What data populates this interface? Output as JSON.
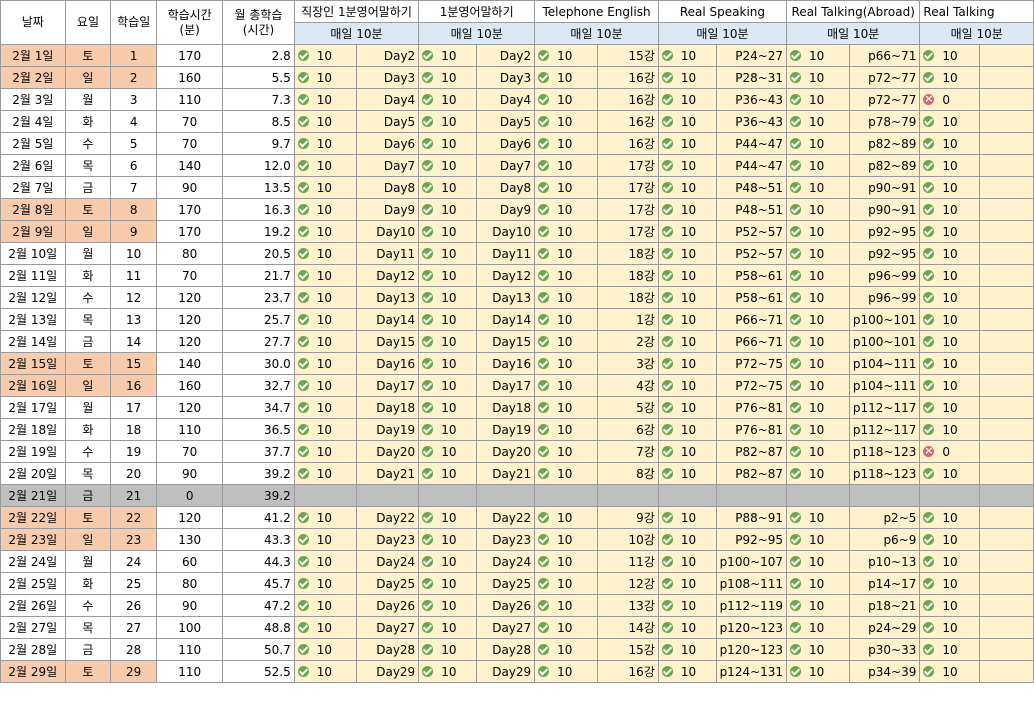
{
  "headers": {
    "date": "날짜",
    "weekday": "요일",
    "study_day": "학습일",
    "study_time": "학습시간\n(분)",
    "monthly_total": "월 총학습\n(시간)"
  },
  "courses": [
    {
      "title": "직장인 1분영어말하기",
      "sub": "매일 10분"
    },
    {
      "title": "1분영어말하기",
      "sub": "매일 10분"
    },
    {
      "title": "Telephone English",
      "sub": "매일 10분"
    },
    {
      "title": "Real Speaking",
      "sub": "매일 10분"
    },
    {
      "title": "Real Talking(Abroad)",
      "sub": "매일 10분"
    },
    {
      "title": "Real Talking",
      "sub": "매일 10분"
    }
  ],
  "status_icons": {
    "done": "check-circle-icon",
    "missed": "cross-circle-icon"
  },
  "colors": {
    "weekend": "#f8cbad",
    "holiday": "#bfbfbf",
    "cell": "#fff2cc",
    "subheader": "#dbe9f5",
    "check": "#6aa84f",
    "cross": "#e06666"
  },
  "rows": [
    {
      "date": "2월 1일",
      "wd": "토",
      "n": "1",
      "min": "170",
      "total": "2.8",
      "weekend": true,
      "off": false,
      "c": [
        [
          "ok",
          "10",
          "Day2"
        ],
        [
          "ok",
          "10",
          "Day2"
        ],
        [
          "ok",
          "10",
          "15강"
        ],
        [
          "ok",
          "10",
          "P24~27"
        ],
        [
          "ok",
          "10",
          "p66~71"
        ],
        [
          "ok",
          "10",
          ""
        ]
      ]
    },
    {
      "date": "2월 2일",
      "wd": "일",
      "n": "2",
      "min": "160",
      "total": "5.5",
      "weekend": true,
      "off": false,
      "c": [
        [
          "ok",
          "10",
          "Day3"
        ],
        [
          "ok",
          "10",
          "Day3"
        ],
        [
          "ok",
          "10",
          "16강"
        ],
        [
          "ok",
          "10",
          "P28~31"
        ],
        [
          "ok",
          "10",
          "p72~77"
        ],
        [
          "ok",
          "10",
          ""
        ]
      ]
    },
    {
      "date": "2월 3일",
      "wd": "월",
      "n": "3",
      "min": "110",
      "total": "7.3",
      "weekend": false,
      "off": false,
      "c": [
        [
          "ok",
          "10",
          "Day4"
        ],
        [
          "ok",
          "10",
          "Day4"
        ],
        [
          "ok",
          "10",
          "16강"
        ],
        [
          "ok",
          "10",
          "P36~43"
        ],
        [
          "ok",
          "10",
          "p72~77"
        ],
        [
          "ng",
          "0",
          ""
        ]
      ]
    },
    {
      "date": "2월 4일",
      "wd": "화",
      "n": "4",
      "min": "70",
      "total": "8.5",
      "weekend": false,
      "off": false,
      "c": [
        [
          "ok",
          "10",
          "Day5"
        ],
        [
          "ok",
          "10",
          "Day5"
        ],
        [
          "ok",
          "10",
          "16강"
        ],
        [
          "ok",
          "10",
          "P36~43"
        ],
        [
          "ok",
          "10",
          "p78~79"
        ],
        [
          "ok",
          "10",
          ""
        ]
      ]
    },
    {
      "date": "2월 5일",
      "wd": "수",
      "n": "5",
      "min": "70",
      "total": "9.7",
      "weekend": false,
      "off": false,
      "c": [
        [
          "ok",
          "10",
          "Day6"
        ],
        [
          "ok",
          "10",
          "Day6"
        ],
        [
          "ok",
          "10",
          "16강"
        ],
        [
          "ok",
          "10",
          "P44~47"
        ],
        [
          "ok",
          "10",
          "p82~89"
        ],
        [
          "ok",
          "10",
          ""
        ]
      ]
    },
    {
      "date": "2월 6일",
      "wd": "목",
      "n": "6",
      "min": "140",
      "total": "12.0",
      "weekend": false,
      "off": false,
      "c": [
        [
          "ok",
          "10",
          "Day7"
        ],
        [
          "ok",
          "10",
          "Day7"
        ],
        [
          "ok",
          "10",
          "17강"
        ],
        [
          "ok",
          "10",
          "P44~47"
        ],
        [
          "ok",
          "10",
          "p82~89"
        ],
        [
          "ok",
          "10",
          ""
        ]
      ]
    },
    {
      "date": "2월 7일",
      "wd": "금",
      "n": "7",
      "min": "90",
      "total": "13.5",
      "weekend": false,
      "off": false,
      "c": [
        [
          "ok",
          "10",
          "Day8"
        ],
        [
          "ok",
          "10",
          "Day8"
        ],
        [
          "ok",
          "10",
          "17강"
        ],
        [
          "ok",
          "10",
          "P48~51"
        ],
        [
          "ok",
          "10",
          "p90~91"
        ],
        [
          "ok",
          "10",
          ""
        ]
      ]
    },
    {
      "date": "2월 8일",
      "wd": "토",
      "n": "8",
      "min": "170",
      "total": "16.3",
      "weekend": true,
      "off": false,
      "c": [
        [
          "ok",
          "10",
          "Day9"
        ],
        [
          "ok",
          "10",
          "Day9"
        ],
        [
          "ok",
          "10",
          "17강"
        ],
        [
          "ok",
          "10",
          "P48~51"
        ],
        [
          "ok",
          "10",
          "p90~91"
        ],
        [
          "ok",
          "10",
          ""
        ]
      ]
    },
    {
      "date": "2월 9일",
      "wd": "일",
      "n": "9",
      "min": "170",
      "total": "19.2",
      "weekend": true,
      "off": false,
      "c": [
        [
          "ok",
          "10",
          "Day10"
        ],
        [
          "ok",
          "10",
          "Day10"
        ],
        [
          "ok",
          "10",
          "17강"
        ],
        [
          "ok",
          "10",
          "P52~57"
        ],
        [
          "ok",
          "10",
          "p92~95"
        ],
        [
          "ok",
          "10",
          ""
        ]
      ]
    },
    {
      "date": "2월 10일",
      "wd": "월",
      "n": "10",
      "min": "80",
      "total": "20.5",
      "weekend": false,
      "off": false,
      "c": [
        [
          "ok",
          "10",
          "Day11"
        ],
        [
          "ok",
          "10",
          "Day11"
        ],
        [
          "ok",
          "10",
          "18강"
        ],
        [
          "ok",
          "10",
          "P52~57"
        ],
        [
          "ok",
          "10",
          "p92~95"
        ],
        [
          "ok",
          "10",
          ""
        ]
      ]
    },
    {
      "date": "2월 11일",
      "wd": "화",
      "n": "11",
      "min": "70",
      "total": "21.7",
      "weekend": false,
      "off": false,
      "c": [
        [
          "ok",
          "10",
          "Day12"
        ],
        [
          "ok",
          "10",
          "Day12"
        ],
        [
          "ok",
          "10",
          "18강"
        ],
        [
          "ok",
          "10",
          "P58~61"
        ],
        [
          "ok",
          "10",
          "p96~99"
        ],
        [
          "ok",
          "10",
          ""
        ]
      ]
    },
    {
      "date": "2월 12일",
      "wd": "수",
      "n": "12",
      "min": "120",
      "total": "23.7",
      "weekend": false,
      "off": false,
      "c": [
        [
          "ok",
          "10",
          "Day13"
        ],
        [
          "ok",
          "10",
          "Day13"
        ],
        [
          "ok",
          "10",
          "18강"
        ],
        [
          "ok",
          "10",
          "P58~61"
        ],
        [
          "ok",
          "10",
          "p96~99"
        ],
        [
          "ok",
          "10",
          ""
        ]
      ]
    },
    {
      "date": "2월 13일",
      "wd": "목",
      "n": "13",
      "min": "120",
      "total": "25.7",
      "weekend": false,
      "off": false,
      "c": [
        [
          "ok",
          "10",
          "Day14"
        ],
        [
          "ok",
          "10",
          "Day14"
        ],
        [
          "ok",
          "10",
          "1강"
        ],
        [
          "ok",
          "10",
          "P66~71"
        ],
        [
          "ok",
          "10",
          "p100~101"
        ],
        [
          "ok",
          "10",
          ""
        ]
      ]
    },
    {
      "date": "2월 14일",
      "wd": "금",
      "n": "14",
      "min": "120",
      "total": "27.7",
      "weekend": false,
      "off": false,
      "c": [
        [
          "ok",
          "10",
          "Day15"
        ],
        [
          "ok",
          "10",
          "Day15"
        ],
        [
          "ok",
          "10",
          "2강"
        ],
        [
          "ok",
          "10",
          "P66~71"
        ],
        [
          "ok",
          "10",
          "p100~101"
        ],
        [
          "ok",
          "10",
          ""
        ]
      ]
    },
    {
      "date": "2월 15일",
      "wd": "토",
      "n": "15",
      "min": "140",
      "total": "30.0",
      "weekend": true,
      "off": false,
      "c": [
        [
          "ok",
          "10",
          "Day16"
        ],
        [
          "ok",
          "10",
          "Day16"
        ],
        [
          "ok",
          "10",
          "3강"
        ],
        [
          "ok",
          "10",
          "P72~75"
        ],
        [
          "ok",
          "10",
          "p104~111"
        ],
        [
          "ok",
          "10",
          ""
        ]
      ]
    },
    {
      "date": "2월 16일",
      "wd": "일",
      "n": "16",
      "min": "160",
      "total": "32.7",
      "weekend": true,
      "off": false,
      "c": [
        [
          "ok",
          "10",
          "Day17"
        ],
        [
          "ok",
          "10",
          "Day17"
        ],
        [
          "ok",
          "10",
          "4강"
        ],
        [
          "ok",
          "10",
          "P72~75"
        ],
        [
          "ok",
          "10",
          "p104~111"
        ],
        [
          "ok",
          "10",
          ""
        ]
      ]
    },
    {
      "date": "2월 17일",
      "wd": "월",
      "n": "17",
      "min": "120",
      "total": "34.7",
      "weekend": false,
      "off": false,
      "c": [
        [
          "ok",
          "10",
          "Day18"
        ],
        [
          "ok",
          "10",
          "Day18"
        ],
        [
          "ok",
          "10",
          "5강"
        ],
        [
          "ok",
          "10",
          "P76~81"
        ],
        [
          "ok",
          "10",
          "p112~117"
        ],
        [
          "ok",
          "10",
          ""
        ]
      ]
    },
    {
      "date": "2월 18일",
      "wd": "화",
      "n": "18",
      "min": "110",
      "total": "36.5",
      "weekend": false,
      "off": false,
      "c": [
        [
          "ok",
          "10",
          "Day19"
        ],
        [
          "ok",
          "10",
          "Day19"
        ],
        [
          "ok",
          "10",
          "6강"
        ],
        [
          "ok",
          "10",
          "P76~81"
        ],
        [
          "ok",
          "10",
          "p112~117"
        ],
        [
          "ok",
          "10",
          ""
        ]
      ]
    },
    {
      "date": "2월 19일",
      "wd": "수",
      "n": "19",
      "min": "70",
      "total": "37.7",
      "weekend": false,
      "off": false,
      "c": [
        [
          "ok",
          "10",
          "Day20"
        ],
        [
          "ok",
          "10",
          "Day20"
        ],
        [
          "ok",
          "10",
          "7강"
        ],
        [
          "ok",
          "10",
          "P82~87"
        ],
        [
          "ok",
          "10",
          "p118~123"
        ],
        [
          "ng",
          "0",
          ""
        ]
      ]
    },
    {
      "date": "2월 20일",
      "wd": "목",
      "n": "20",
      "min": "90",
      "total": "39.2",
      "weekend": false,
      "off": false,
      "c": [
        [
          "ok",
          "10",
          "Day21"
        ],
        [
          "ok",
          "10",
          "Day21"
        ],
        [
          "ok",
          "10",
          "8강"
        ],
        [
          "ok",
          "10",
          "P82~87"
        ],
        [
          "ok",
          "10",
          "p118~123"
        ],
        [
          "ok",
          "10",
          ""
        ]
      ]
    },
    {
      "date": "2월 21일",
      "wd": "금",
      "n": "21",
      "min": "0",
      "total": "39.2",
      "weekend": false,
      "off": true,
      "c": []
    },
    {
      "date": "2월 22일",
      "wd": "토",
      "n": "22",
      "min": "120",
      "total": "41.2",
      "weekend": true,
      "off": false,
      "c": [
        [
          "ok",
          "10",
          "Day22"
        ],
        [
          "ok",
          "10",
          "Day22"
        ],
        [
          "ok",
          "10",
          "9강"
        ],
        [
          "ok",
          "10",
          "P88~91"
        ],
        [
          "ok",
          "10",
          "p2~5"
        ],
        [
          "ok",
          "10",
          ""
        ]
      ]
    },
    {
      "date": "2월 23일",
      "wd": "일",
      "n": "23",
      "min": "130",
      "total": "43.3",
      "weekend": true,
      "off": false,
      "c": [
        [
          "ok",
          "10",
          "Day23"
        ],
        [
          "ok",
          "10",
          "Day23"
        ],
        [
          "ok",
          "10",
          "10강"
        ],
        [
          "ok",
          "10",
          "P92~95"
        ],
        [
          "ok",
          "10",
          "p6~9"
        ],
        [
          "ok",
          "10",
          ""
        ]
      ]
    },
    {
      "date": "2월 24일",
      "wd": "월",
      "n": "24",
      "min": "60",
      "total": "44.3",
      "weekend": false,
      "off": false,
      "c": [
        [
          "ok",
          "10",
          "Day24"
        ],
        [
          "ok",
          "10",
          "Day24"
        ],
        [
          "ok",
          "10",
          "11강"
        ],
        [
          "ok",
          "10",
          "p100~107"
        ],
        [
          "ok",
          "10",
          "p10~13"
        ],
        [
          "ok",
          "10",
          ""
        ]
      ]
    },
    {
      "date": "2월 25일",
      "wd": "화",
      "n": "25",
      "min": "80",
      "total": "45.7",
      "weekend": false,
      "off": false,
      "c": [
        [
          "ok",
          "10",
          "Day25"
        ],
        [
          "ok",
          "10",
          "Day25"
        ],
        [
          "ok",
          "10",
          "12강"
        ],
        [
          "ok",
          "10",
          "p108~111"
        ],
        [
          "ok",
          "10",
          "p14~17"
        ],
        [
          "ok",
          "10",
          ""
        ]
      ]
    },
    {
      "date": "2월 26일",
      "wd": "수",
      "n": "26",
      "min": "90",
      "total": "47.2",
      "weekend": false,
      "off": false,
      "c": [
        [
          "ok",
          "10",
          "Day26"
        ],
        [
          "ok",
          "10",
          "Day26"
        ],
        [
          "ok",
          "10",
          "13강"
        ],
        [
          "ok",
          "10",
          "p112~119"
        ],
        [
          "ok",
          "10",
          "p18~21"
        ],
        [
          "ok",
          "10",
          ""
        ]
      ]
    },
    {
      "date": "2월 27일",
      "wd": "목",
      "n": "27",
      "min": "100",
      "total": "48.8",
      "weekend": false,
      "off": false,
      "c": [
        [
          "ok",
          "10",
          "Day27"
        ],
        [
          "ok",
          "10",
          "Day27"
        ],
        [
          "ok",
          "10",
          "14강"
        ],
        [
          "ok",
          "10",
          "p120~123"
        ],
        [
          "ok",
          "10",
          "p24~29"
        ],
        [
          "ok",
          "10",
          ""
        ]
      ]
    },
    {
      "date": "2월 28일",
      "wd": "금",
      "n": "28",
      "min": "110",
      "total": "50.7",
      "weekend": false,
      "off": false,
      "c": [
        [
          "ok",
          "10",
          "Day28"
        ],
        [
          "ok",
          "10",
          "Day28"
        ],
        [
          "ok",
          "10",
          "15강"
        ],
        [
          "ok",
          "10",
          "p120~123"
        ],
        [
          "ok",
          "10",
          "p30~33"
        ],
        [
          "ok",
          "10",
          ""
        ]
      ]
    },
    {
      "date": "2월 29일",
      "wd": "토",
      "n": "29",
      "min": "110",
      "total": "52.5",
      "weekend": true,
      "off": false,
      "c": [
        [
          "ok",
          "10",
          "Day29"
        ],
        [
          "ok",
          "10",
          "Day29"
        ],
        [
          "ok",
          "10",
          "16강"
        ],
        [
          "ok",
          "10",
          "p124~131"
        ],
        [
          "ok",
          "10",
          "p34~39"
        ],
        [
          "ok",
          "10",
          ""
        ]
      ]
    }
  ]
}
